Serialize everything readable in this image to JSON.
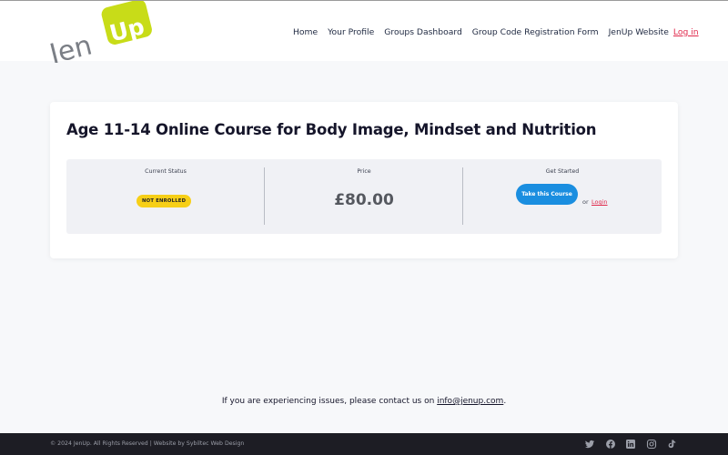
{
  "brand": {
    "logo_text_jen": "Jen",
    "logo_text_up": "Up",
    "accent_color": "#c8dc18"
  },
  "nav": {
    "items": [
      {
        "label": "Home"
      },
      {
        "label": "Your Profile"
      },
      {
        "label": "Groups Dashboard"
      },
      {
        "label": "Group Code Registration Form"
      },
      {
        "label": "JenUp Website"
      }
    ],
    "login_label": "Log in"
  },
  "course": {
    "title": "Age 11-14 Online Course for Body Image, Mindset and Nutrition",
    "status_label": "Current Status",
    "status_value": "NOT ENROLLED",
    "price_label": "Price",
    "price_value": "£80.00",
    "get_started_label": "Get Started",
    "take_course_label": "Take this Course",
    "or_text": "or",
    "login_label": "Login"
  },
  "support": {
    "text": "If you are experiencing issues, please contact us on ",
    "email": "info@jenup.com",
    "suffix": "."
  },
  "footer": {
    "copyright": "© 2024 JenUp. All Rights Reserved | Website by Sybiltec Web Design",
    "social": [
      "twitter-icon",
      "facebook-icon",
      "linkedin-icon",
      "instagram-icon",
      "tiktok-icon"
    ]
  },
  "colors": {
    "badge": "#f7cf17",
    "button": "#1a8ee0",
    "link": "#e0284b",
    "footer_bg": "#1d1d24"
  }
}
